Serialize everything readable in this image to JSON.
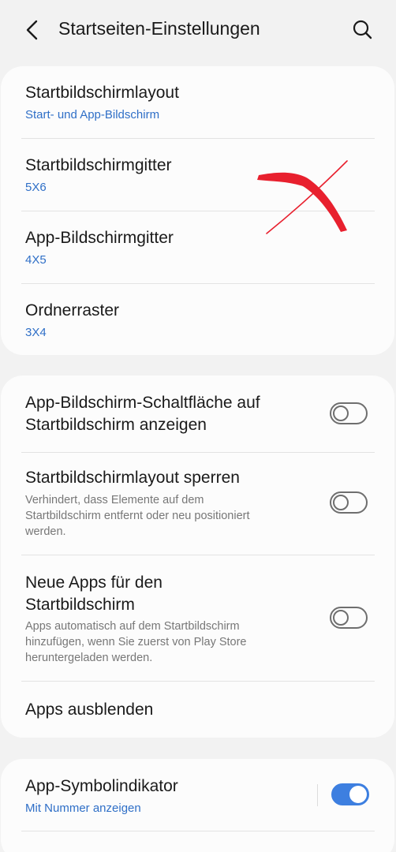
{
  "header": {
    "title": "Startseiten-Einstellungen"
  },
  "card1": {
    "rows": [
      {
        "title": "Startbildschirmlayout",
        "value": "Start- und App-Bildschirm"
      },
      {
        "title": "Startbildschirmgitter",
        "value": "5X6"
      },
      {
        "title": "App-Bildschirmgitter",
        "value": "4X5"
      },
      {
        "title": "Ordnerraster",
        "value": "3X4"
      }
    ]
  },
  "card2": {
    "app_button": {
      "line1": "App-Bildschirm-Schaltfläche auf",
      "line2": "Startbildschirm anzeigen",
      "enabled": false
    },
    "lock_layout": {
      "title": "Startbildschirmlayout sperren",
      "desc1": "Verhindert, dass Elemente auf dem",
      "desc2": "Startbildschirm entfernt oder neu positioniert",
      "desc3": "werden.",
      "enabled": false
    },
    "new_apps": {
      "line1": "Neue Apps für den",
      "line2": "Startbildschirm",
      "desc1": "Apps automatisch auf dem Startbildschirm",
      "desc2": "hinzufügen, wenn Sie zuerst von Play Store",
      "desc3": "heruntergeladen werden.",
      "enabled": false
    },
    "hide_apps": {
      "title": "Apps ausblenden"
    }
  },
  "card3": {
    "badge": {
      "title": "App-Symbolindikator",
      "value": "Mit Nummer anzeigen",
      "enabled": true
    }
  },
  "colors": {
    "accent": "#3d7fe0",
    "link": "#2f6fc7",
    "annotation": "#e8202e"
  }
}
